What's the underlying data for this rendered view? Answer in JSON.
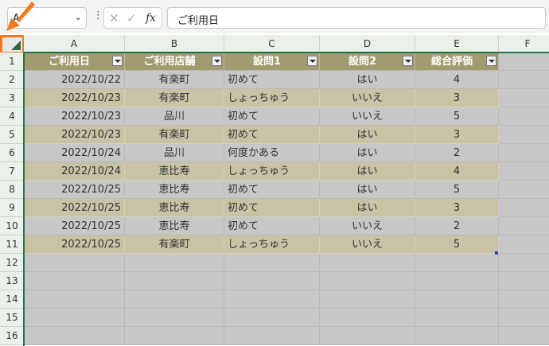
{
  "formula_bar": {
    "name_box": "A",
    "fx_label": "fx",
    "formula": "ご利用日"
  },
  "columns": [
    "A",
    "B",
    "C",
    "D",
    "E",
    "F"
  ],
  "rows": [
    "1",
    "2",
    "3",
    "4",
    "5",
    "6",
    "7",
    "8",
    "9",
    "10",
    "11",
    "12",
    "13",
    "14",
    "15",
    "16"
  ],
  "table": {
    "headers": [
      "ご利用日",
      "ご利用店舗",
      "設問1",
      "設問2",
      "総合評価"
    ],
    "data": [
      [
        "2022/10/22",
        "有楽町",
        "初めて",
        "はい",
        "4"
      ],
      [
        "2022/10/23",
        "有楽町",
        "しょっちゅう",
        "いいえ",
        "3"
      ],
      [
        "2022/10/23",
        "品川",
        "初めて",
        "いいえ",
        "5"
      ],
      [
        "2022/10/23",
        "有楽町",
        "初めて",
        "はい",
        "3"
      ],
      [
        "2022/10/24",
        "品川",
        "何度かある",
        "はい",
        "2"
      ],
      [
        "2022/10/24",
        "恵比寿",
        "しょっちゅう",
        "はい",
        "4"
      ],
      [
        "2022/10/25",
        "恵比寿",
        "初めて",
        "はい",
        "5"
      ],
      [
        "2022/10/25",
        "恵比寿",
        "初めて",
        "はい",
        "3"
      ],
      [
        "2022/10/25",
        "恵比寿",
        "初めて",
        "いいえ",
        "2"
      ],
      [
        "2022/10/25",
        "有楽町",
        "しょっちゅう",
        "いいえ",
        "5"
      ]
    ]
  },
  "colors": {
    "header_fill": "#a39b70",
    "band_fill": "#c9c3a6",
    "selection_fill": "#c7c7c7",
    "highlight": "#f07a1c",
    "excel_green": "#217346"
  }
}
